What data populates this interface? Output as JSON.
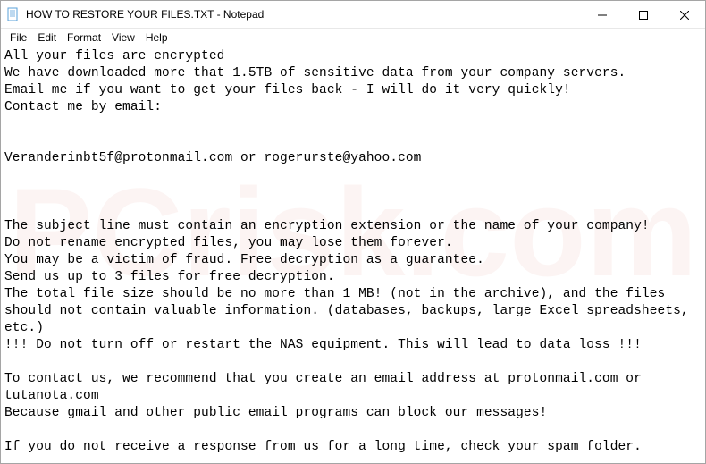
{
  "window": {
    "title": "HOW TO RESTORE YOUR FILES.TXT - Notepad",
    "app": "Notepad"
  },
  "menu": {
    "file": "File",
    "edit": "Edit",
    "format": "Format",
    "view": "View",
    "help": "Help"
  },
  "content": {
    "lines": [
      "All your files are encrypted",
      "We have downloaded more that 1.5TB of sensitive data from your company servers.",
      "Email me if you want to get your files back - I will do it very quickly!",
      "Contact me by email:",
      "",
      "",
      "Veranderinbt5f@protonmail.com or rogerurste@yahoo.com",
      "",
      "",
      "",
      "The subject line must contain an encryption extension or the name of your company!",
      "Do not rename encrypted files, you may lose them forever.",
      "You may be a victim of fraud. Free decryption as a guarantee.",
      "Send us up to 3 files for free decryption.",
      "The total file size should be no more than 1 MB! (not in the archive), and the files",
      "should not contain valuable information. (databases, backups, large Excel spreadsheets,",
      "etc.)",
      "!!! Do not turn off or restart the NAS equipment. This will lead to data loss !!!",
      "",
      "To contact us, we recommend that you create an email address at protonmail.com or",
      "tutanota.com",
      "Because gmail and other public email programs can block our messages!",
      "",
      "If you do not receive a response from us for a long time, check your spam folder."
    ]
  },
  "watermark": "PCrisk.com"
}
